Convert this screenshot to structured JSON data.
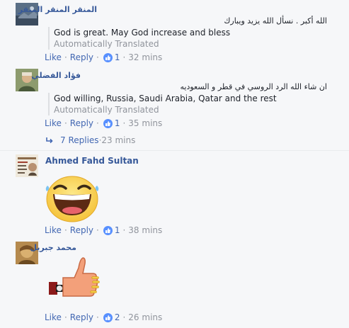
{
  "comments": [
    {
      "author": "المنقر المنقر المنقر",
      "body": "الله أكبر . نسأل الله يزيد ويبارك",
      "translation": "God is great. May God increase and bless",
      "translation_note": "Automatically Translated",
      "like_label": "Like",
      "reply_label": "Reply",
      "like_count": "1",
      "time": "32 mins"
    },
    {
      "author": "فؤاد الفضلي",
      "body": "ان شاء الله الرد الروسي في قطر و السعوديه",
      "translation": "God willing, Russia, Saudi Arabia, Qatar and the rest",
      "translation_note": "Automatically Translated",
      "like_label": "Like",
      "reply_label": "Reply",
      "like_count": "1",
      "time": "35 mins",
      "replies_label": "7 Replies",
      "replies_time": "23 mins"
    },
    {
      "author": "Ahmed Fahd Sultan",
      "sticker": "laughing-face",
      "like_label": "Like",
      "reply_label": "Reply",
      "like_count": "1",
      "time": "38 mins"
    },
    {
      "author": "محمد جبريل",
      "sticker": "thumbs-up-hand",
      "like_label": "Like",
      "reply_label": "Reply",
      "like_count": "2",
      "time": "26 mins"
    }
  ],
  "colors": {
    "link": "#4267b2",
    "author": "#365899",
    "meta": "#90949c",
    "like_badge": "#5890ff",
    "background": "#f6f7f9"
  },
  "icons": [
    "thumbs-up-icon",
    "reply-arrow-icon"
  ]
}
